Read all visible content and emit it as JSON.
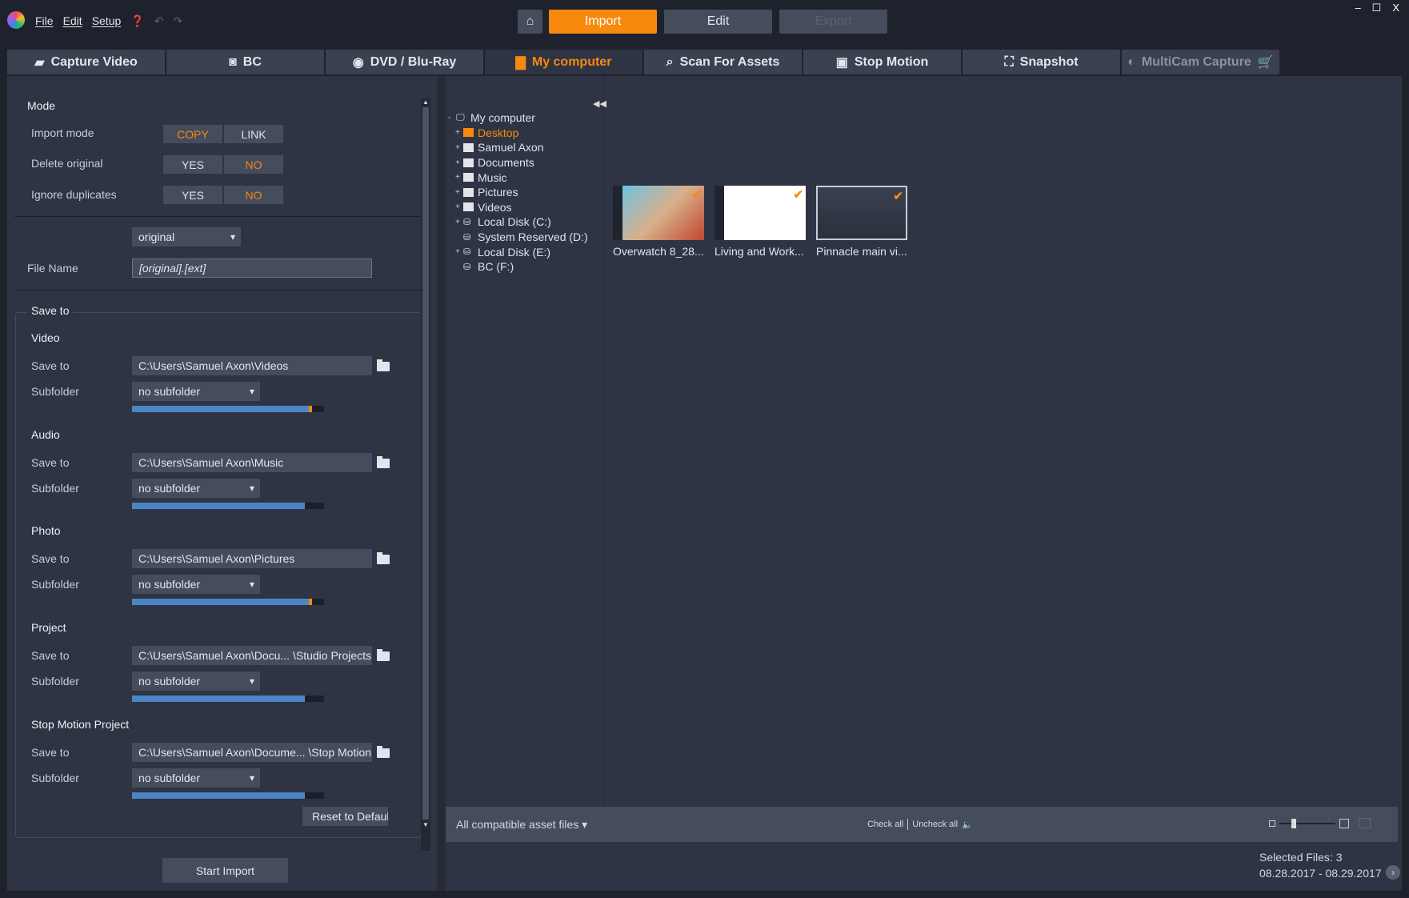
{
  "menu": {
    "file": "File",
    "edit": "Edit",
    "setup": "Setup"
  },
  "top": {
    "import": "Import",
    "edit": "Edit",
    "export": "Export"
  },
  "tabs": [
    {
      "label": "Capture Video",
      "icon": "camcorder-icon"
    },
    {
      "label": "BC",
      "icon": "camera-icon"
    },
    {
      "label": "DVD / Blu-Ray",
      "icon": "disc-icon"
    },
    {
      "label": "My computer",
      "icon": "folder-icon"
    },
    {
      "label": "Scan For Assets",
      "icon": "search-icon"
    },
    {
      "label": "Stop Motion",
      "icon": "stop-motion-icon"
    },
    {
      "label": "Snapshot",
      "icon": "snapshot-icon"
    },
    {
      "label": "MultiCam Capture",
      "icon": "multicam-icon"
    }
  ],
  "mode": {
    "title": "Mode",
    "import_mode": "Import mode",
    "copy": "COPY",
    "link": "LINK",
    "delete_original": "Delete original",
    "ignore_duplicates": "Ignore duplicates",
    "yes": "YES",
    "no": "NO"
  },
  "naming": {
    "option": "original",
    "file_name_label": "File Name",
    "file_name": "[original].[ext]"
  },
  "save": {
    "title": "Save to",
    "save_label": "Save to",
    "subfolder_label": "Subfolder",
    "sections": [
      {
        "title": "Video",
        "path": "C:\\Users\\Samuel Axon\\Videos",
        "subfolder": "no subfolder",
        "usage": 0.92
      },
      {
        "title": "Audio",
        "path": "C:\\Users\\Samuel Axon\\Music",
        "subfolder": "no subfolder",
        "usage": 0.9
      },
      {
        "title": "Photo",
        "path": "C:\\Users\\Samuel Axon\\Pictures",
        "subfolder": "no subfolder",
        "usage": 0.92
      },
      {
        "title": "Project",
        "path": "C:\\Users\\Samuel Axon\\Docu...  \\Studio Projects",
        "subfolder": "no subfolder",
        "usage": 0.9
      },
      {
        "title": "Stop Motion Project",
        "path": "C:\\Users\\Samuel Axon\\Docume...  \\Stop Motion",
        "subfolder": "no subfolder",
        "usage": 0.9
      }
    ],
    "reset": "Reset to Default"
  },
  "start_import": "Start Import",
  "tree": [
    {
      "label": "My computer",
      "exp": "-",
      "type": "pc"
    },
    {
      "label": "Desktop",
      "exp": "+",
      "type": "folder",
      "active": true
    },
    {
      "label": "Samuel Axon",
      "exp": "+",
      "type": "folder"
    },
    {
      "label": "Documents",
      "exp": "+",
      "type": "folder"
    },
    {
      "label": "Music",
      "exp": "+",
      "type": "folder"
    },
    {
      "label": "Pictures",
      "exp": "+",
      "type": "folder"
    },
    {
      "label": "Videos",
      "exp": "+",
      "type": "folder"
    },
    {
      "label": "Local Disk (C:)",
      "exp": "+",
      "type": "drive"
    },
    {
      "label": "System Reserved (D:)",
      "exp": "",
      "type": "drive"
    },
    {
      "label": "Local Disk (E:)",
      "exp": "+",
      "type": "drive"
    },
    {
      "label": "BC (F:)",
      "exp": "",
      "type": "drive"
    }
  ],
  "files": [
    {
      "name": "Overwatch 8_28..."
    },
    {
      "name": "Living and Work..."
    },
    {
      "name": "Pinnacle main vi..."
    }
  ],
  "bottom": {
    "filter": "All compatible asset files",
    "check_all": "Check all",
    "uncheck_all": "Uncheck all",
    "selected": "Selected Files: 3",
    "date_range": "08.28.2017 - 08.29.2017",
    "zoom_level": 0.25
  },
  "colors": {
    "accent": "#f7890f",
    "bar": "#4a86c6"
  }
}
